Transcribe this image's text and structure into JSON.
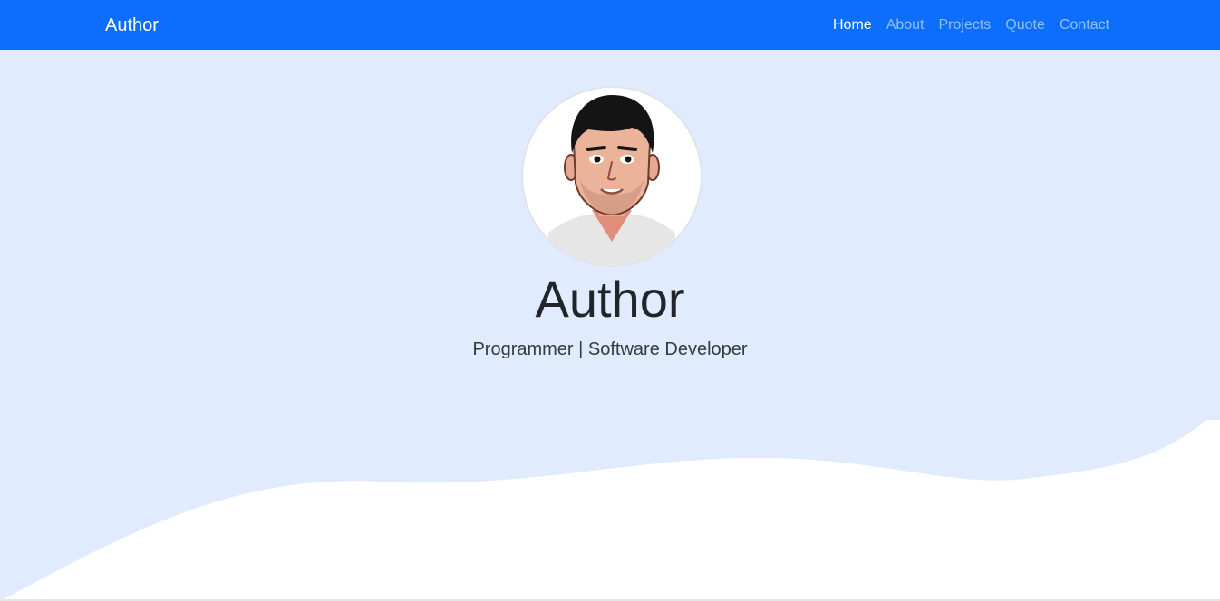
{
  "navbar": {
    "brand": "Author",
    "links": [
      {
        "label": "Home",
        "active": true
      },
      {
        "label": "About",
        "active": false
      },
      {
        "label": "Projects",
        "active": false
      },
      {
        "label": "Quote",
        "active": false
      },
      {
        "label": "Contact",
        "active": false
      }
    ]
  },
  "hero": {
    "avatar_icon": "cartoon-man-avatar",
    "title": "Author",
    "subtitle": "Programmer | Software Developer"
  },
  "colors": {
    "navbar_bg": "#0d6efd",
    "hero_bg": "#e0ecfe",
    "wave": "#ffffff"
  }
}
